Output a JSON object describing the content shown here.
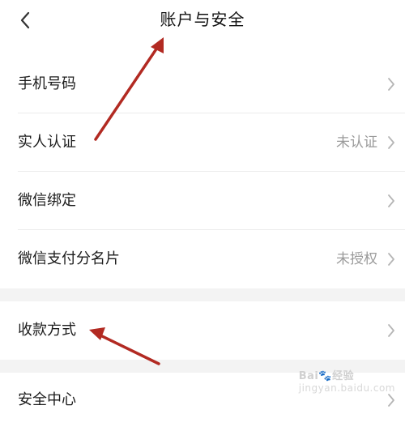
{
  "header": {
    "title": "账户与安全",
    "back_icon": "chevron-left-icon"
  },
  "items": [
    {
      "label": "手机号码",
      "value": ""
    },
    {
      "label": "实人认证",
      "value": "未认证"
    },
    {
      "label": "微信绑定",
      "value": ""
    },
    {
      "label": "微信支付分名片",
      "value": "未授权"
    },
    {
      "label": "收款方式",
      "value": ""
    },
    {
      "label": "安全中心",
      "value": ""
    }
  ],
  "watermark": {
    "brand": "Bai",
    "suffix": "经验",
    "sub": "jingyan.baidu.com"
  },
  "colors": {
    "annotation_arrow": "#b22a22",
    "section_gap": "#f3f3f3",
    "divider": "#ececec",
    "secondary_text": "#9a9a9a"
  }
}
